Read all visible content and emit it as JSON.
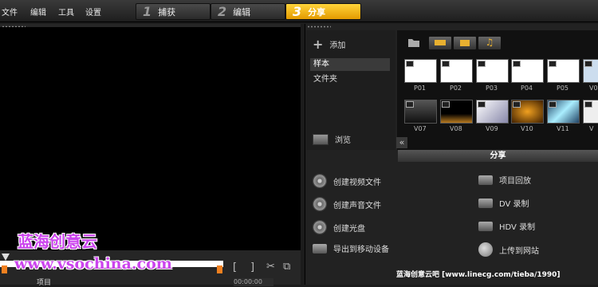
{
  "menu": [
    "文件",
    "编辑",
    "工具",
    "设置"
  ],
  "steps": [
    {
      "num": "1",
      "label": "捕获"
    },
    {
      "num": "2",
      "label": "编辑"
    },
    {
      "num": "3",
      "label": "分享"
    }
  ],
  "left": {
    "controls": {
      "bracket_in": "[",
      "bracket_out": "]",
      "scissors": "✂",
      "copy": "⧉"
    },
    "project_label": "项目",
    "timecode": "00:00:00"
  },
  "watermark": {
    "line1": "蓝海创意云",
    "line2": "www.vsochina.com"
  },
  "library": {
    "add_label": "添加",
    "items": [
      "样本",
      "文件夹"
    ],
    "browse_label": "浏览",
    "collapse_glyph": "«"
  },
  "thumbs": {
    "row1": [
      "P01",
      "P02",
      "P03",
      "P04",
      "P05",
      "V0"
    ],
    "row2": [
      "V07",
      "V08",
      "V09",
      "V10",
      "V11",
      "V"
    ]
  },
  "share": {
    "title": "分享",
    "left_items": [
      "创建视频文件",
      "创建声音文件",
      "创建光盘",
      "导出到移动设备"
    ],
    "right_items": [
      "项目回放",
      "DV 录制",
      "HDV 录制",
      "上传到网站"
    ]
  },
  "footer": "蓝海创意云吧 [www.linecg.com/tieba/1990]",
  "colors": {
    "active_step": "#ffd43a",
    "watermark": "#cc44ee",
    "accent_marker": "#f08020"
  }
}
